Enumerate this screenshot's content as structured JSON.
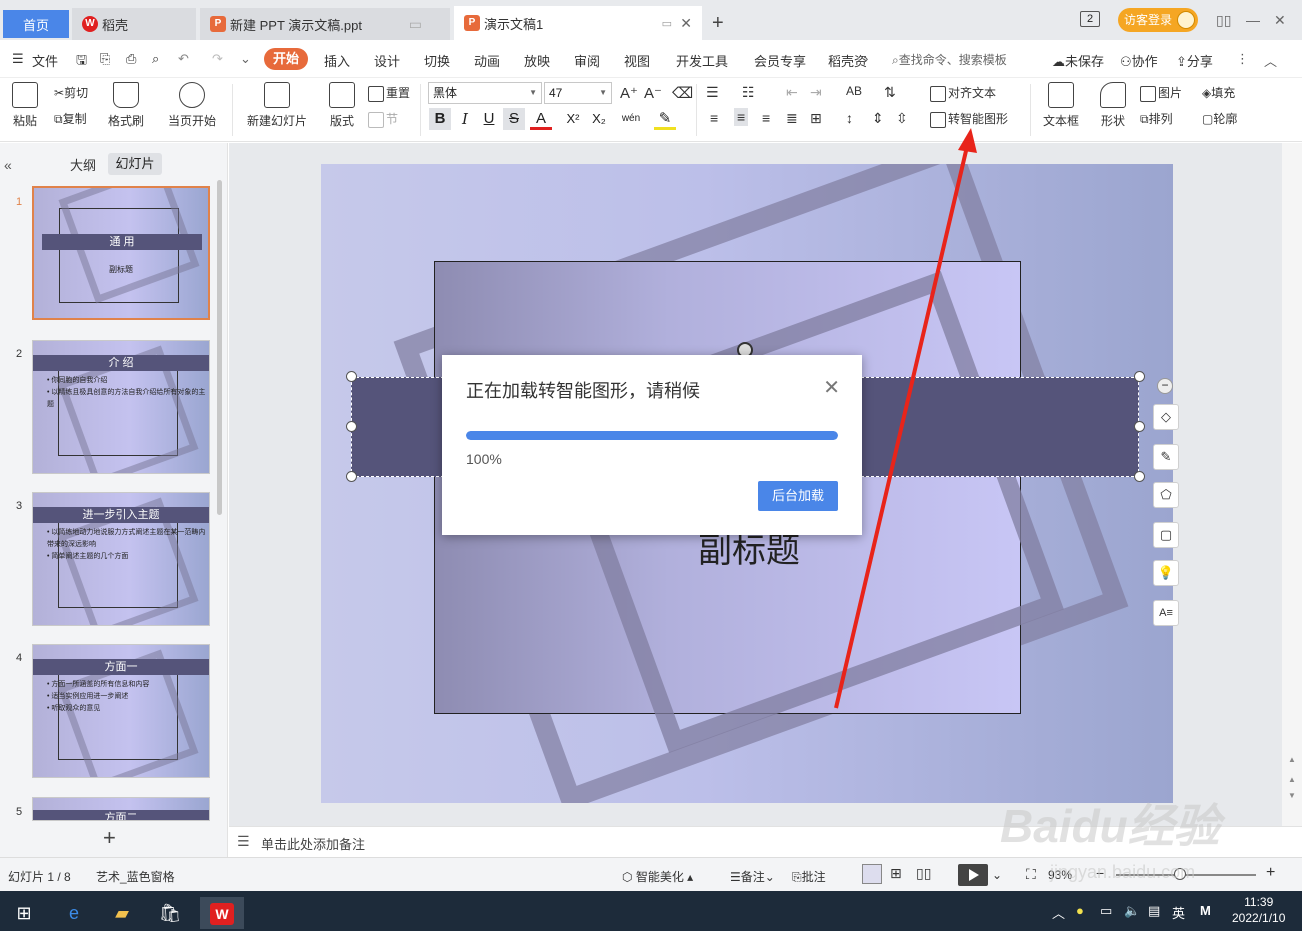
{
  "tabs": {
    "home": "首页",
    "daoke": "稻壳",
    "ppt": "新建 PPT 演示文稿.ppt",
    "doc1": "演示文稿1"
  },
  "window": {
    "badge": "2",
    "login": "访客登录"
  },
  "menu": {
    "file": "文件",
    "start": "开始",
    "items": [
      "插入",
      "设计",
      "切换",
      "动画",
      "放映",
      "审阅",
      "视图",
      "开发工具",
      "会员专享",
      "稻壳资"
    ],
    "search": "查找命令、搜索模板",
    "unsaved": "未保存",
    "collab": "协作",
    "share": "分享"
  },
  "ribbon": {
    "paste": "粘贴",
    "cut": "剪切",
    "copy": "复制",
    "format_painter": "格式刷",
    "from_start": "当页开始",
    "new_slide": "新建幻灯片",
    "layout": "版式",
    "reset": "重置",
    "section": "节",
    "font": "黑体",
    "size": "47",
    "align_text": "对齐文本",
    "convert_smartart": "转智能图形",
    "textbox": "文本框",
    "shape": "形状",
    "picture": "图片",
    "arrange": "排列",
    "fill": "填充",
    "outline": "轮廓",
    "bold": "B",
    "italic": "I",
    "underline": "U",
    "strike": "S",
    "fontcolor": "A",
    "superscript": "X²",
    "subscript": "X₂",
    "phonetic": "wén"
  },
  "panel": {
    "outline_tab": "大纲",
    "slides_tab": "幻灯片"
  },
  "thumbs": [
    {
      "num": "1",
      "title": "通  用",
      "sub": "副标题"
    },
    {
      "num": "2",
      "title": "介  绍",
      "bullets": [
        "• 你同胞的自我介绍",
        "• 以精练且极具创意的方法自我介绍给所有对象的主题"
      ]
    },
    {
      "num": "3",
      "title": "进一步引入主题",
      "bullets": [
        "• 以简练地动力地说服力方式阐述主题在某一范畴内带来的深远影响",
        "• 简单阐述主题的几个方面"
      ]
    },
    {
      "num": "4",
      "title": "方面一",
      "bullets": [
        "• 方面一所涵盖的所有信息和内容",
        "• 适当实例应用进一步阐述",
        "• 听取观众的意见"
      ]
    },
    {
      "num": "5",
      "title": "方面二"
    }
  ],
  "slide": {
    "subtitle": "副标题"
  },
  "dialog": {
    "title": "正在加载转智能图形，请稍候",
    "progress": 1.0,
    "progress_text": "100%",
    "button": "后台加载"
  },
  "notes": {
    "placeholder": "单击此处添加备注"
  },
  "status": {
    "slide_count": "幻灯片 1 / 8",
    "theme": "艺术_蓝色窗格",
    "smart": "智能美化",
    "notes": "备注",
    "comment": "批注",
    "zoom": "93%"
  },
  "taskbar": {
    "lang": "英",
    "ime": "M",
    "time": "11:39",
    "date": "2022/1/10"
  },
  "watermark": {
    "logo": "Baidu经验",
    "url": "jingyan.baidu.com"
  },
  "colors": {
    "accent": "#4a86e8",
    "start_tab": "#e76a3b",
    "arrow": "#e8241a",
    "title_bar": "#55547a",
    "login": "#f5a623"
  }
}
